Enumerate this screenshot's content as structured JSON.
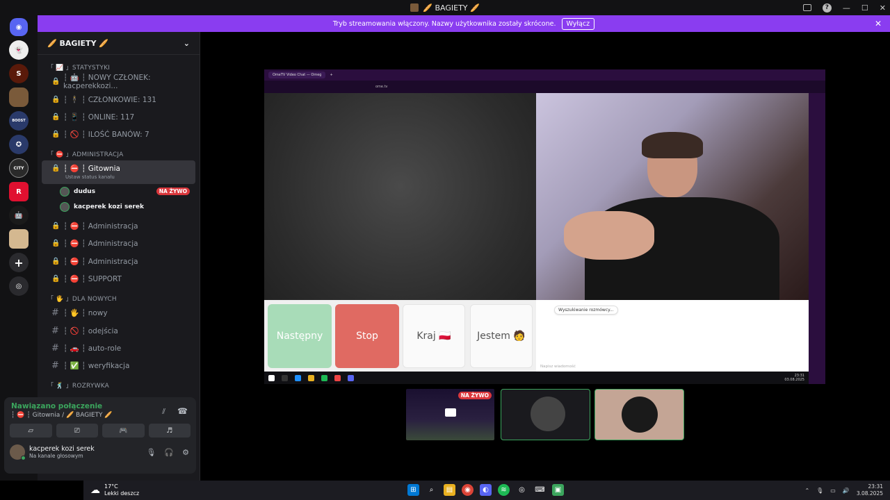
{
  "titlebar": {
    "title": "🥖 BAGIETY 🥖"
  },
  "banner": {
    "text": "Tryb streamowania włączony. Nazwy użytkownika zostały skrócone.",
    "button": "Wyłącz"
  },
  "guild": {
    "name": "🥖 BAGIETY 🥖"
  },
  "categories": {
    "stats": "「 📈 」STATYSTYKI",
    "admin": "「 ⛔ 」ADMINISTRACJA",
    "new": "「 🖐 」DLA NOWYCH",
    "fun": "「 🕺 」ROZRYWKA"
  },
  "stat_channels": [
    "┆ 🤖 ┆ NOWY CZŁONEK: kacperekkozi...",
    "┆ 🕴 ┆ CZŁONKOWIE: 131",
    "┆ 📱 ┆ ONLINE: 117",
    "┆ 🚫 ┆ ILOŚĆ BANÓW: 7"
  ],
  "active_channel": {
    "name": "┆ ⛔ ┆ Gitownia",
    "status": "Ustaw status kanału"
  },
  "voice_users": [
    {
      "name": "dudus",
      "live": "NA ŻYWO"
    },
    {
      "name": "kacperek kozi serek"
    }
  ],
  "admin_channels": [
    "┆ ⛔ ┆ Administracja",
    "┆ ⛔ ┆ Administracja",
    "┆ ⛔ ┆ Administracja",
    "┆ ⛔ ┆ SUPPORT"
  ],
  "new_channels": [
    "┆ 🖐 ┆ nowy",
    "┆ 🚫 ┆ odejścia",
    "┆ 🚗 ┆ auto-role",
    "┆ ✅ ┆ weryfikacja"
  ],
  "voice_panel": {
    "status": "Nawiązano połączenie",
    "channel": "┆ ⛔ ┆ Gitownia / 🥖 BAGIETY 🥖"
  },
  "user": {
    "name": "kacperek kozi serek",
    "status": "Na kanale głosowym"
  },
  "stream": {
    "tab": "OmeTV Video Chat — Omeg",
    "url": "ome.tv",
    "btn_next": "Następny",
    "btn_stop": "Stop",
    "btn_country": "Kraj 🇵🇱",
    "btn_gender": "Jestem 🧑",
    "chat_msg": "Wyszukiwanie rozmówcy...",
    "chat_placeholder": "Napisz wiadomość",
    "time": "23:31",
    "date": "03.08.2025"
  },
  "tile_live": "NA ŻYWO",
  "taskbar": {
    "temp": "17°C",
    "weather": "Lekki deszcz",
    "time": "23:31",
    "date": "3.08.2025"
  },
  "colors": {
    "accent": "#8a3df0",
    "live": "#da373c",
    "connected": "#3ba55d"
  }
}
